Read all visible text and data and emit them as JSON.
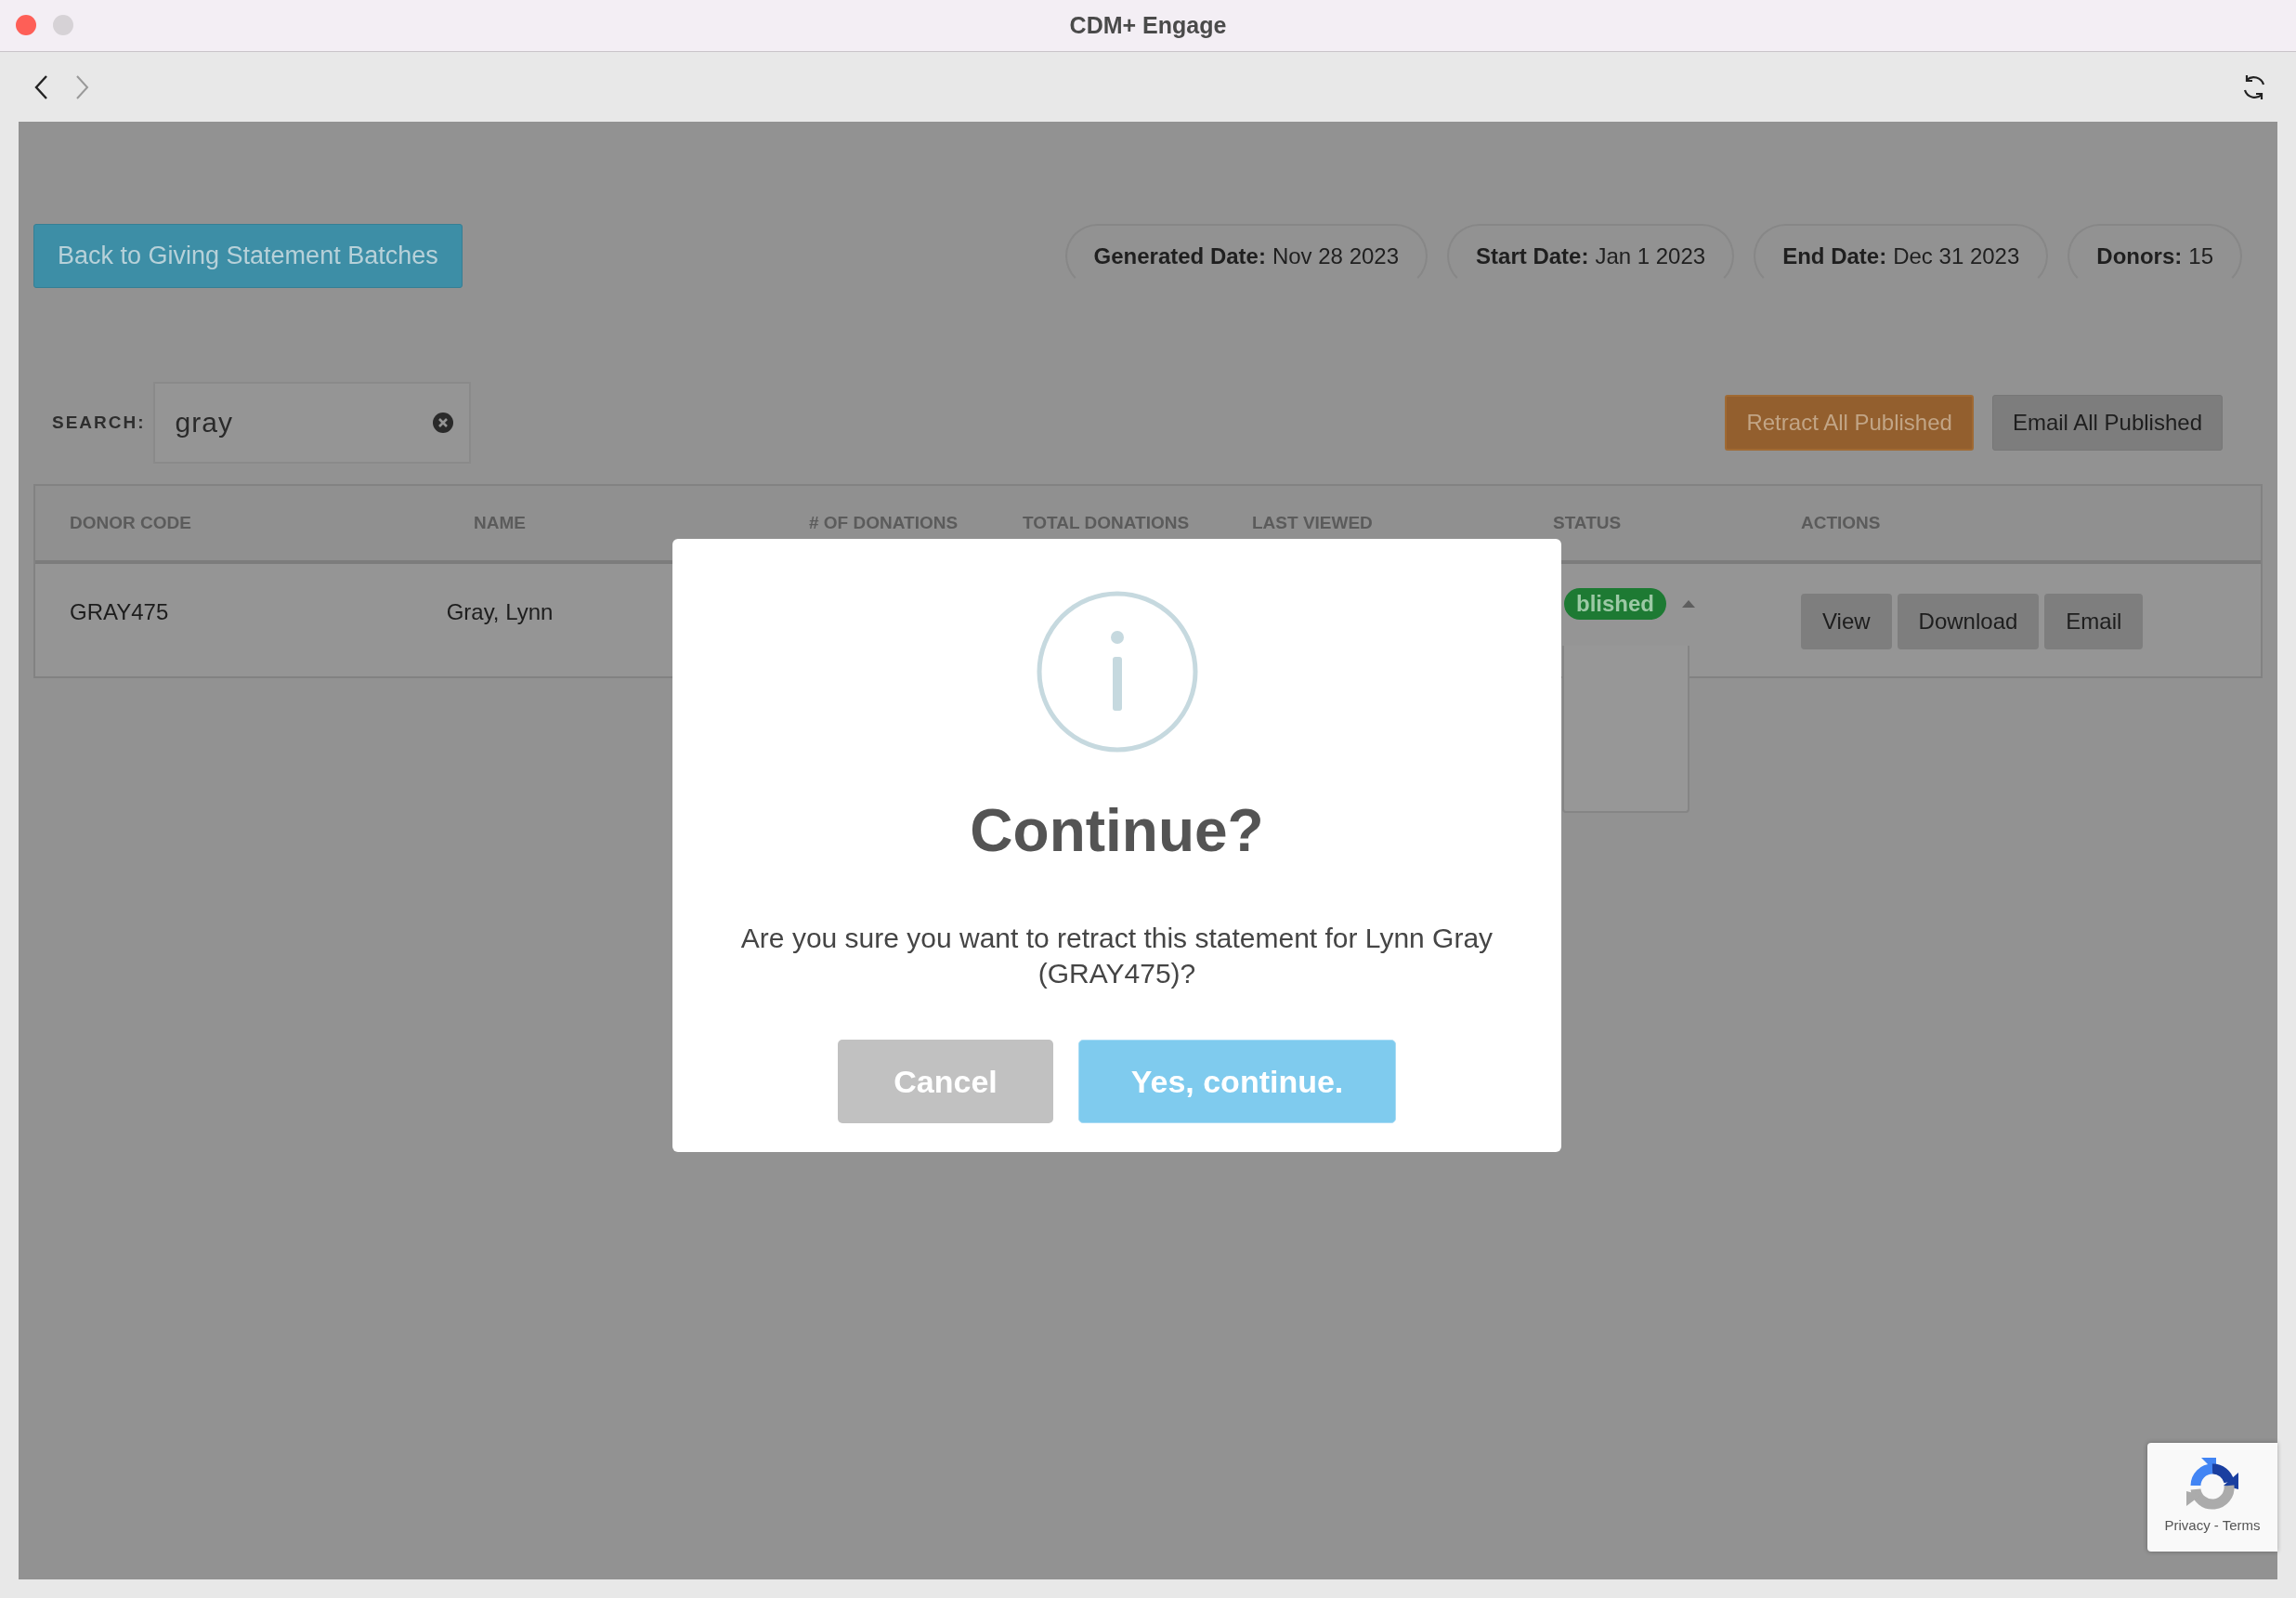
{
  "window": {
    "title": "CDM+ Engage"
  },
  "back_button": "Back to Giving Statement Batches",
  "summary": [
    {
      "label": "Generated Date:",
      "value": "Nov 28 2023"
    },
    {
      "label": "Start Date:",
      "value": "Jan 1 2023"
    },
    {
      "label": "End Date:",
      "value": "Dec 31 2023"
    },
    {
      "label": "Donors:",
      "value": "15"
    }
  ],
  "search": {
    "label": "SEARCH:",
    "value": "gray"
  },
  "bulk_actions": [
    {
      "label": "Retract All Published",
      "kind": "warning"
    },
    {
      "label": "Email All Published",
      "kind": "default"
    }
  ],
  "table": {
    "columns": [
      "DONOR CODE",
      "NAME",
      "# OF DONATIONS",
      "TOTAL DONATIONS",
      "LAST VIEWED",
      "STATUS",
      "ACTIONS"
    ],
    "rows": [
      {
        "donor_code": "GRAY475",
        "name": "Gray, Lynn",
        "status": "blished",
        "status_menu_expanded": true,
        "actions": [
          "View",
          "Download",
          "Email"
        ]
      }
    ]
  },
  "dialog": {
    "title": "Continue?",
    "message": "Are you sure you want to retract this statement for Lynn Gray (GRAY475)?",
    "buttons": [
      {
        "label": "Cancel",
        "kind": "cancel"
      },
      {
        "label": "Yes, continue.",
        "kind": "confirm"
      }
    ]
  },
  "recaptcha": {
    "links": "Privacy - Terms"
  }
}
